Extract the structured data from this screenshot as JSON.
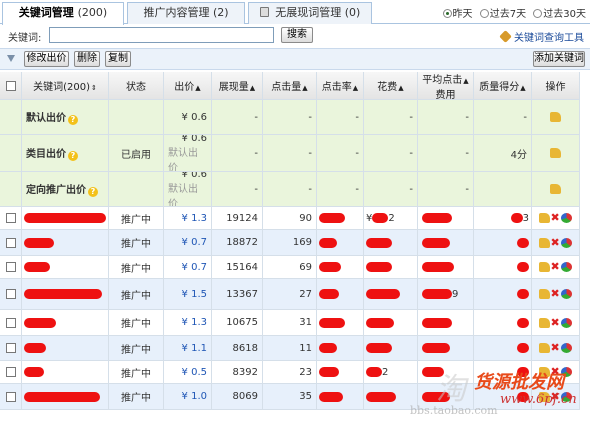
{
  "tabs": [
    {
      "label": "关键词管理",
      "count": "(200)",
      "active": true
    },
    {
      "label": "推广内容管理",
      "count": "(2)",
      "active": false
    },
    {
      "label": "无展现词管理",
      "count": "(0)",
      "active": false
    }
  ],
  "period_options": [
    {
      "label": "昨天",
      "selected": true
    },
    {
      "label": "过去7天",
      "selected": false
    },
    {
      "label": "过去30天",
      "selected": false
    }
  ],
  "search": {
    "label": "关键词:",
    "value": "",
    "button": "搜索"
  },
  "tool_link": "关键词查询工具",
  "toolbar": {
    "modify_bid": "修改出价",
    "delete": "删除",
    "copy": "复制",
    "add_keyword": "添加关键词"
  },
  "columns": {
    "keyword": "关键词(200)",
    "status": "状态",
    "bid": "出价",
    "impressions": "展现量",
    "clicks": "点击量",
    "ctr": "点击率",
    "cost": "花费",
    "avg_cpc_1": "平均点击",
    "avg_cpc_2": "费用",
    "quality": "质量得分",
    "action": "操作"
  },
  "default_rows": [
    {
      "name": "默认出价",
      "status": "",
      "bid": "¥ 0.6",
      "bid_note": "",
      "impressions": "-",
      "clicks": "-",
      "ctr": "-",
      "cost": "-",
      "avg_cpc": "-",
      "quality": "-"
    },
    {
      "name": "类目出价",
      "status": "已启用",
      "bid": "¥ 0.6",
      "bid_note": "默认出价",
      "impressions": "-",
      "clicks": "-",
      "ctr": "-",
      "cost": "-",
      "avg_cpc": "-",
      "quality": "4分"
    },
    {
      "name": "定向推广出价",
      "status": "",
      "bid": "¥ 0.6",
      "bid_note": "默认出价",
      "impressions": "-",
      "clicks": "-",
      "ctr": "-",
      "cost": "-",
      "avg_cpc": "-",
      "quality": ""
    }
  ],
  "keyword_rows": [
    {
      "status": "推广中",
      "bid": "¥ 1.3",
      "impressions": "19124",
      "clicks": "90",
      "cost_prefix": "¥",
      "cost_suffix": "2",
      "avg_cpc_suffix": "",
      "quality_suffix": "3"
    },
    {
      "status": "推广中",
      "bid": "¥ 0.7",
      "impressions": "18872",
      "clicks": "169",
      "cost_prefix": "",
      "cost_suffix": "",
      "avg_cpc_suffix": "",
      "quality_suffix": ""
    },
    {
      "status": "推广中",
      "bid": "¥ 0.7",
      "impressions": "15164",
      "clicks": "69",
      "cost_prefix": "",
      "cost_suffix": "",
      "avg_cpc_suffix": "",
      "quality_suffix": ""
    },
    {
      "status": "推广中",
      "bid": "¥ 1.5",
      "impressions": "13367",
      "clicks": "27",
      "cost_prefix": "",
      "cost_suffix": "",
      "avg_cpc_suffix": "9",
      "quality_suffix": ""
    },
    {
      "status": "推广中",
      "bid": "¥ 1.3",
      "impressions": "10675",
      "clicks": "31",
      "cost_prefix": "",
      "cost_suffix": "",
      "avg_cpc_suffix": "",
      "quality_suffix": ""
    },
    {
      "status": "推广中",
      "bid": "¥ 1.1",
      "impressions": "8618",
      "clicks": "11",
      "cost_prefix": "",
      "cost_suffix": "",
      "avg_cpc_suffix": "",
      "quality_suffix": ""
    },
    {
      "status": "推广中",
      "bid": "¥ 0.5",
      "impressions": "8392",
      "clicks": "23",
      "cost_prefix": "",
      "cost_suffix": "2",
      "avg_cpc_suffix": "",
      "quality_suffix": ""
    },
    {
      "status": "推广中",
      "bid": "¥ 1.0",
      "impressions": "8069",
      "clicks": "35",
      "cost_prefix": "",
      "cost_suffix": "",
      "avg_cpc_suffix": "",
      "quality_suffix": ""
    }
  ],
  "watermarks": [
    "淘",
    "货源批发网",
    "www.6pf.cn",
    "bbs.taobao.com"
  ],
  "colors": {
    "accent_blue": "#1f56b5",
    "redaction": "#ee1111",
    "default_row_bg": "#eaf5dc",
    "keyword_row_bg": "#e7f0fb"
  }
}
